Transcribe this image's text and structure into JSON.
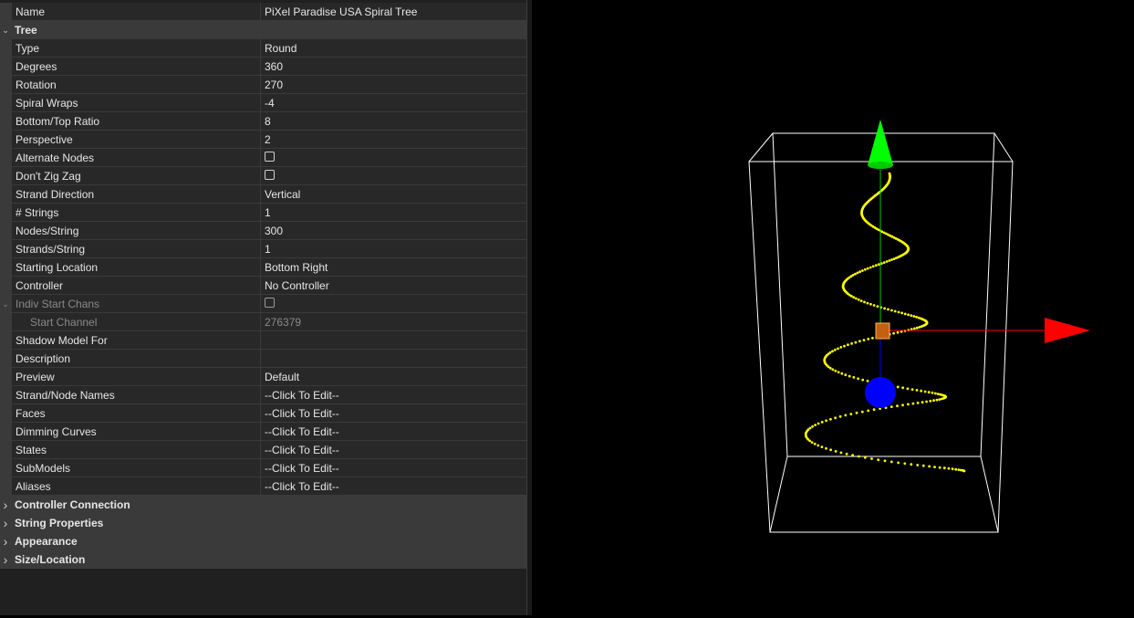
{
  "properties": [
    {
      "kind": "prop",
      "name": "Name",
      "value": "PiXel Paradise USA Spiral Tree"
    },
    {
      "kind": "cat",
      "name": "Tree",
      "expanded": true
    },
    {
      "kind": "prop",
      "name": "Type",
      "value": "Round"
    },
    {
      "kind": "prop",
      "name": "Degrees",
      "value": "360"
    },
    {
      "kind": "prop",
      "name": "Rotation",
      "value": "270"
    },
    {
      "kind": "prop",
      "name": "Spiral Wraps",
      "value": "-4"
    },
    {
      "kind": "prop",
      "name": "Bottom/Top Ratio",
      "value": "8"
    },
    {
      "kind": "prop",
      "name": "Perspective",
      "value": "2"
    },
    {
      "kind": "prop",
      "name": "Alternate Nodes",
      "value": "",
      "checkbox": true,
      "checked": false
    },
    {
      "kind": "prop",
      "name": "Don't Zig Zag",
      "value": "",
      "checkbox": true,
      "checked": false
    },
    {
      "kind": "prop",
      "name": "Strand Direction",
      "value": "Vertical"
    },
    {
      "kind": "prop",
      "name": "# Strings",
      "value": "1"
    },
    {
      "kind": "prop",
      "name": "Nodes/String",
      "value": "300"
    },
    {
      "kind": "prop",
      "name": "Strands/String",
      "value": "1"
    },
    {
      "kind": "prop",
      "name": "Starting Location",
      "value": "Bottom Right"
    },
    {
      "kind": "prop",
      "name": "Controller",
      "value": "No Controller"
    },
    {
      "kind": "prop",
      "name": "Indiv Start Chans",
      "value": "",
      "checkbox": true,
      "checked": false,
      "disabled": true,
      "expander": true
    },
    {
      "kind": "prop",
      "name": "Start Channel",
      "value": "276379",
      "disabled": true,
      "sub": true
    },
    {
      "kind": "prop",
      "name": "Shadow Model For",
      "value": ""
    },
    {
      "kind": "prop",
      "name": "Description",
      "value": ""
    },
    {
      "kind": "prop",
      "name": "Preview",
      "value": "Default"
    },
    {
      "kind": "prop",
      "name": "Strand/Node Names",
      "value": "--Click To Edit--"
    },
    {
      "kind": "prop",
      "name": "Faces",
      "value": "--Click To Edit--"
    },
    {
      "kind": "prop",
      "name": "Dimming Curves",
      "value": "--Click To Edit--"
    },
    {
      "kind": "prop",
      "name": "States",
      "value": "--Click To Edit--"
    },
    {
      "kind": "prop",
      "name": "SubModels",
      "value": "--Click To Edit--"
    },
    {
      "kind": "prop",
      "name": "Aliases",
      "value": "--Click To Edit--"
    },
    {
      "kind": "cat",
      "name": "Controller Connection",
      "expanded": false
    },
    {
      "kind": "cat",
      "name": "String Properties",
      "expanded": false
    },
    {
      "kind": "cat",
      "name": "Appearance",
      "expanded": false
    },
    {
      "kind": "cat",
      "name": "Size/Location",
      "expanded": false
    }
  ],
  "icons": {
    "expanded": "chevron-down-icon",
    "collapsed": "chevron-right-icon",
    "checkbox": "checkbox-icon"
  },
  "viewport": {
    "model": "spiral-tree",
    "nodes": 300,
    "spiral_wraps": -4,
    "colors": {
      "background": "#000000",
      "nodes": "#ffff00",
      "bounding_box": "#ffffff",
      "axis_x": "#ff0000",
      "axis_y": "#00ff00",
      "axis_z": "#0000ff",
      "center_handle": "#c06010"
    }
  }
}
